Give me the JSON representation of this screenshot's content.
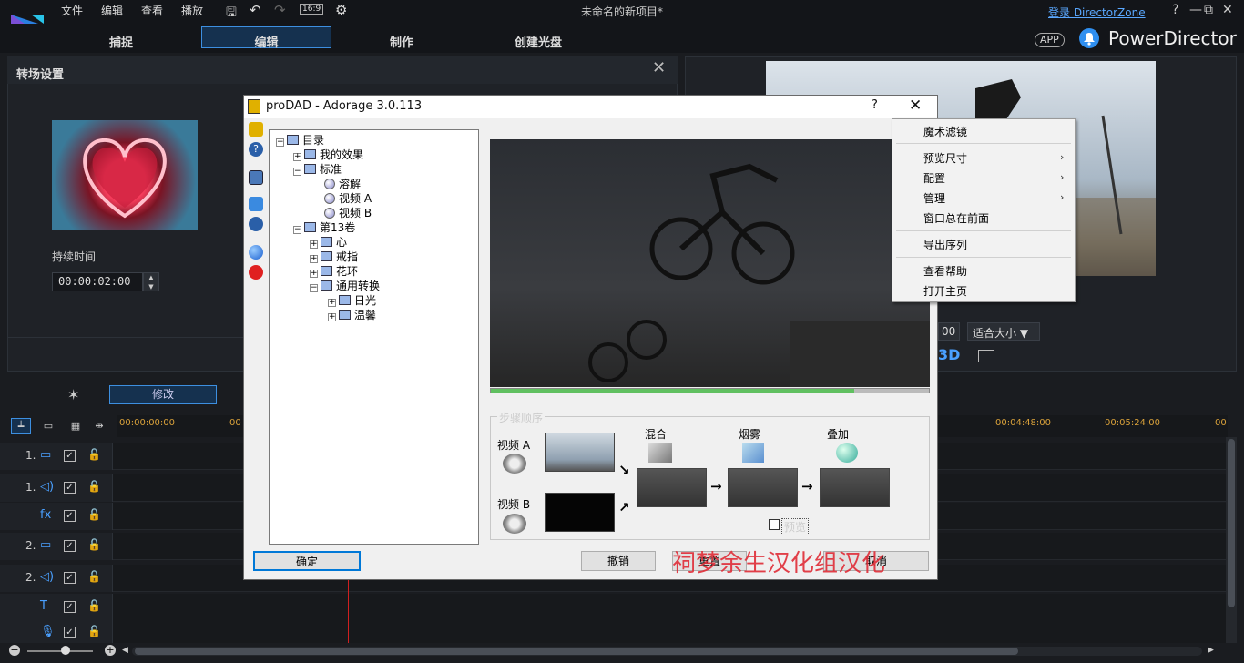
{
  "app": {
    "title": "未命名的新项目*",
    "login_link": "登录 DirectorZone",
    "brand": "PowerDirector",
    "app_badge": "APP",
    "menus": [
      "文件",
      "编辑",
      "查看",
      "播放"
    ],
    "ratio": "16:9",
    "win_controls": [
      "?",
      "—",
      "⧉",
      "✕"
    ],
    "accent_color": "#3d8fe0"
  },
  "tabs": [
    "捕捉",
    "编辑",
    "制作",
    "创建光盘"
  ],
  "transition_panel": {
    "title": "转场设置",
    "duration_label": "持续时间",
    "duration_value": "00:00:02:00"
  },
  "preview_panel": {
    "zoom_value": "00",
    "fit_label": "适合大小 ▼",
    "mode_3d": "3D"
  },
  "toolbar": {
    "modify_label": "修改"
  },
  "timeline": {
    "ticks": [
      "00:00:00:00",
      "00",
      "00:04:48:00",
      "00:05:24:00",
      "00"
    ],
    "tracks": [
      {
        "num": "1.",
        "icon": "video-track-icon"
      },
      {
        "num": "1.",
        "icon": "audio-track-icon"
      },
      {
        "num": "",
        "icon": "fx-track-icon"
      },
      {
        "num": "2.",
        "icon": "video-track-icon"
      },
      {
        "num": "2.",
        "icon": "audio-track-icon"
      },
      {
        "num": "",
        "icon": "title-track-icon"
      },
      {
        "num": "",
        "icon": "voice-track-icon"
      }
    ]
  },
  "dialog": {
    "title": "proDAD - Adorage 3.0.113",
    "help": "?",
    "tree": {
      "root": "目录",
      "my_effects": "我的效果",
      "standard": "标准",
      "dissolve": "溶解",
      "video_a": "视频 A",
      "video_b": "视频 B",
      "vol13": "第13卷",
      "heart": "心",
      "ring": "戒指",
      "wreath": "花环",
      "general": "通用转换",
      "daylight": "日光",
      "cozy": "温馨"
    },
    "steps": {
      "label": "步骤顺序",
      "video_a": "视频 A",
      "video_b": "视频 B",
      "mix": "混合",
      "smoke": "烟雾",
      "overlay": "叠加",
      "preview": "预览"
    },
    "buttons": {
      "ok": "确定",
      "undo": "撤销",
      "reset": "重置",
      "cancel": "取消"
    },
    "progress": 0.83,
    "watermark": "祠梦余生汉化组汉化"
  },
  "context_menu": {
    "items": [
      "魔术滤镜",
      "预览尺寸",
      "配置",
      "管理",
      "窗口总在前面",
      "导出序列",
      "查看帮助",
      "打开主页"
    ]
  }
}
